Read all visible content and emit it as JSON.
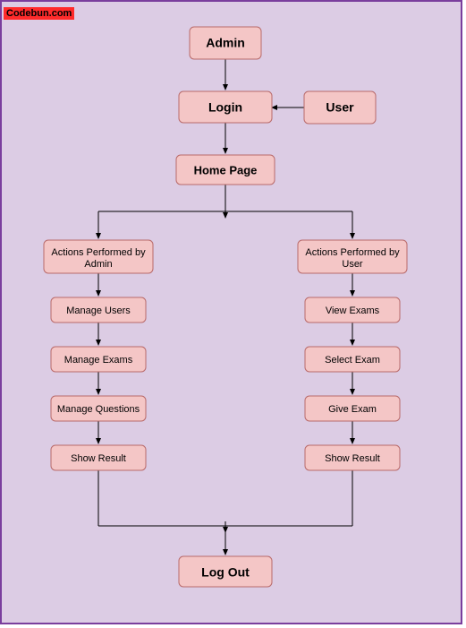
{
  "watermark": "Codebun.com",
  "nodes": {
    "admin": "Admin",
    "user": "User",
    "login": "Login",
    "home": "Home Page",
    "adminActions_l1": "Actions Performed by",
    "adminActions_l2": "Admin",
    "userActions_l1": "Actions Performed by",
    "userActions_l2": "User",
    "manageUsers": "Manage Users",
    "manageExams": "Manage Exams",
    "manageQuestions": "Manage Questions",
    "showResultAdmin": "Show Result",
    "viewExams": "View Exams",
    "selectExam": "Select Exam",
    "giveExam": "Give Exam",
    "showResultUser": "Show Result",
    "logout": "Log Out"
  }
}
